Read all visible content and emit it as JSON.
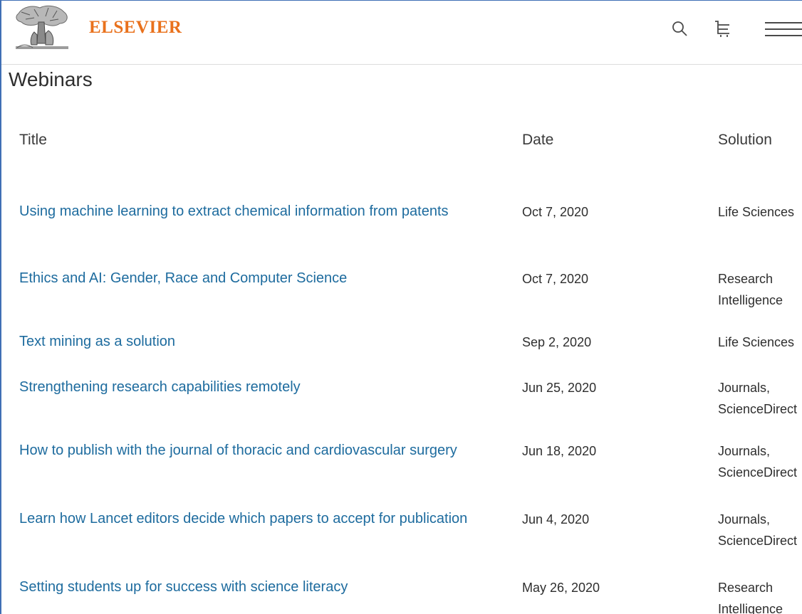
{
  "header": {
    "brand": "ELSEVIER"
  },
  "page": {
    "title": "Webinars"
  },
  "table": {
    "columns": [
      "Title",
      "Date",
      "Solution"
    ],
    "rows": [
      {
        "title": "Using machine learning to extract chemical information from patents",
        "date": "Oct 7, 2020",
        "solution": "Life Sciences"
      },
      {
        "title": "Ethics and AI: Gender, Race and Computer Science",
        "date": "Oct 7, 2020",
        "solution": "Research\nIntelligence"
      },
      {
        "title": "Text mining as a solution",
        "date": "Sep 2, 2020",
        "solution": "Life Sciences"
      },
      {
        "title": "Strengthening research capabilities remotely",
        "date": "Jun 25, 2020",
        "solution": "Journals,\nScienceDirect"
      },
      {
        "title": "How to publish with the journal of thoracic and cardiovascular surgery",
        "date": "Jun 18, 2020",
        "solution": "Journals,\nScienceDirect"
      },
      {
        "title": "Learn how Lancet editors decide which papers to accept for publication",
        "date": "Jun 4, 2020",
        "solution": "Journals,\nScienceDirect"
      },
      {
        "title": "Setting students up for success with science literacy",
        "date": "May 26, 2020",
        "solution": "Research\nIntelligence"
      }
    ]
  },
  "colors": {
    "brand": "#e9711c",
    "link": "#1d6b9e",
    "text": "#2e2e2e",
    "frame": "#3f6fb5"
  },
  "icons": [
    "elsevier-tree-logo",
    "search-icon",
    "cart-icon",
    "menu-icon"
  ]
}
